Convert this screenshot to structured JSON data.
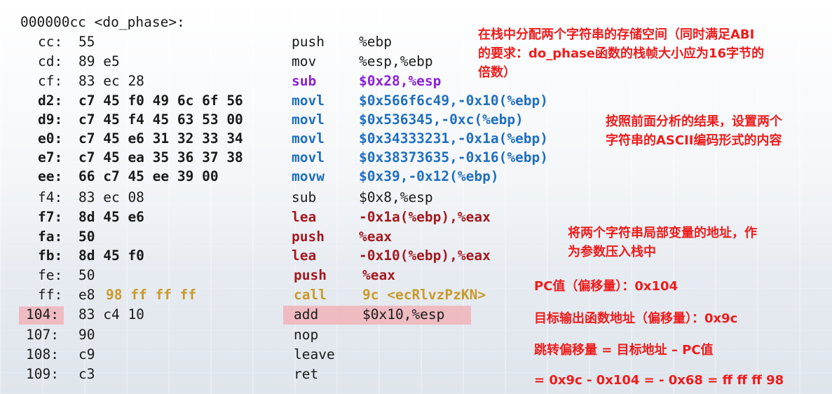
{
  "header": "000000cc <do_phase>:",
  "rows": [
    {
      "addr": "cc:",
      "bytes": "55",
      "mnem": "push",
      "ops": "%ebp"
    },
    {
      "addr": "cd:",
      "bytes": "89 e5",
      "mnem": "mov",
      "ops": "%esp,%ebp"
    },
    {
      "addr": "cf:",
      "bytes": "83 ec 28",
      "mnem": "sub",
      "ops": "$0x28,%esp"
    },
    {
      "addr": "d2:",
      "bytes": "c7 45 f0 49 6c 6f 56",
      "mnem": "movl",
      "ops": "$0x566f6c49,-0x10(%ebp)"
    },
    {
      "addr": "d9:",
      "bytes": "c7 45 f4 45 63 53 00",
      "mnem": "movl",
      "ops": "$0x536345,-0xc(%ebp)"
    },
    {
      "addr": "e0:",
      "bytes": "c7 45 e6 31 32 33 34",
      "mnem": "movl",
      "ops": "$0x34333231,-0x1a(%ebp)"
    },
    {
      "addr": "e7:",
      "bytes": "c7 45 ea 35 36 37 38",
      "mnem": "movl",
      "ops": "$0x38373635,-0x16(%ebp)"
    },
    {
      "addr": "ee:",
      "bytes": "66 c7 45 ee 39 00",
      "mnem": "movw",
      "ops": "$0x39,-0x12(%ebp)"
    },
    {
      "addr": "f4:",
      "bytes": "83 ec 08",
      "mnem": "sub",
      "ops": "$0x8,%esp"
    },
    {
      "addr": "f7:",
      "bytes": "8d 45 e6",
      "mnem": "lea",
      "ops": "-0x1a(%ebp),%eax"
    },
    {
      "addr": "fa:",
      "bytes": "50",
      "mnem": "push",
      "ops": "%eax"
    },
    {
      "addr": "fb:",
      "bytes": "8d 45 f0",
      "mnem": "lea",
      "ops": "-0x10(%ebp),%eax"
    },
    {
      "addr": "fe:",
      "bytes": "50",
      "mnem": "push",
      "ops": "%eax"
    },
    {
      "addr": "ff:",
      "bytes_plain": "e8",
      "bytes_gold": "98 ff ff ff",
      "mnem": "call",
      "ops": "9c <ecRlvzPzKN>"
    },
    {
      "addr": "104:",
      "bytes": "83 c4 10",
      "mnem": "add",
      "ops": "$0x10,%esp"
    },
    {
      "addr": "107:",
      "bytes": "90",
      "mnem": "nop",
      "ops": ""
    },
    {
      "addr": "108:",
      "bytes": "c9",
      "mnem": "leave",
      "ops": ""
    },
    {
      "addr": "109:",
      "bytes": "c3",
      "mnem": "ret",
      "ops": ""
    }
  ],
  "notes": {
    "n1_l1": "在栈中分配两个字符串的存储空间（同时满足ABI",
    "n1_l2": "的要求：do_phase函数的栈帧大小应为16字节的",
    "n1_l3": "倍数）",
    "n2_l1": "按照前面分析的结果，设置两个",
    "n2_l2": "字符串的ASCII编码形式的内容",
    "n3_l1": "将两个字符串局部变量的地址，作",
    "n3_l2": "为参数压入栈中",
    "pc": "PC值（偏移量）：0x104",
    "target": "目标输出函数地址（偏移量）：0x9c",
    "jump": "跳转偏移量 = 目标地址 – PC值",
    "calc": "= 0x9c - 0x104 = - 0x68 = ff ff ff 98"
  }
}
